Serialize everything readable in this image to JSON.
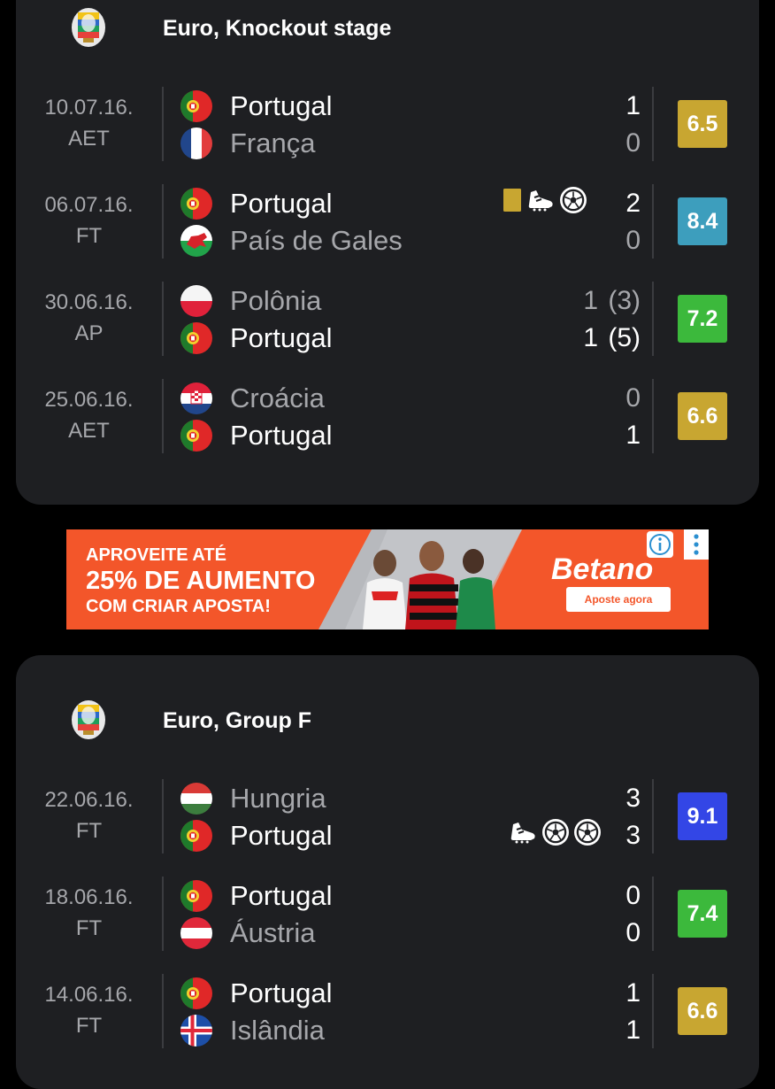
{
  "sections": [
    {
      "league": "Euro, Knockout stage",
      "matches": [
        {
          "date": "10.07.16.",
          "status": "AET",
          "home": {
            "name": "Portugal",
            "flag": "portugal",
            "score": "1",
            "winner": true
          },
          "away": {
            "name": "França",
            "flag": "france",
            "score": "0",
            "winner": false
          },
          "rating": "6.5",
          "rating_color": "#c8a631",
          "events": []
        },
        {
          "date": "06.07.16.",
          "status": "FT",
          "home": {
            "name": "Portugal",
            "flag": "portugal",
            "score": "2",
            "winner": true
          },
          "away": {
            "name": "País de Gales",
            "flag": "wales",
            "score": "0",
            "winner": false
          },
          "rating": "8.4",
          "rating_color": "#3d9ebd",
          "events": [
            "yellow-card",
            "assist-boot",
            "goal-ball"
          ]
        },
        {
          "date": "30.06.16.",
          "status": "AP",
          "home": {
            "name": "Polônia",
            "flag": "poland",
            "score": "1",
            "pen": "(3)",
            "winner": false
          },
          "away": {
            "name": "Portugal",
            "flag": "portugal",
            "score": "1",
            "pen": "(5)",
            "winner": true
          },
          "rating": "7.2",
          "rating_color": "#3cb93c",
          "events": []
        },
        {
          "date": "25.06.16.",
          "status": "AET",
          "home": {
            "name": "Croácia",
            "flag": "croatia",
            "score": "0",
            "winner": false
          },
          "away": {
            "name": "Portugal",
            "flag": "portugal",
            "score": "1",
            "winner": true
          },
          "rating": "6.6",
          "rating_color": "#c8a631",
          "events": []
        }
      ]
    },
    {
      "league": "Euro, Group F",
      "matches": [
        {
          "date": "22.06.16.",
          "status": "FT",
          "home": {
            "name": "Hungria",
            "flag": "hungary",
            "score": "3",
            "winner": false
          },
          "away": {
            "name": "Portugal",
            "flag": "portugal",
            "score": "3",
            "winner": false
          },
          "rating": "9.1",
          "rating_color": "#3346e6",
          "events": [
            "assist-boot",
            "goal-ball",
            "goal-ball"
          ]
        },
        {
          "date": "18.06.16.",
          "status": "FT",
          "home": {
            "name": "Portugal",
            "flag": "portugal",
            "score": "0",
            "winner": false
          },
          "away": {
            "name": "Áustria",
            "flag": "austria",
            "score": "0",
            "winner": false
          },
          "rating": "7.4",
          "rating_color": "#3cb93c",
          "events": []
        },
        {
          "date": "14.06.16.",
          "status": "FT",
          "home": {
            "name": "Portugal",
            "flag": "portugal",
            "score": "1",
            "winner": false
          },
          "away": {
            "name": "Islândia",
            "flag": "iceland",
            "score": "1",
            "winner": false
          },
          "rating": "6.6",
          "rating_color": "#c8a631",
          "events": []
        }
      ]
    }
  ],
  "ad": {
    "line1": "APROVEITE ATÉ",
    "line2": "25% DE AUMENTO",
    "line3": "COM CRIAR APOSTA!",
    "brand": "Betano",
    "cta": "Aposte agora",
    "jersey_brand": "Betano"
  }
}
